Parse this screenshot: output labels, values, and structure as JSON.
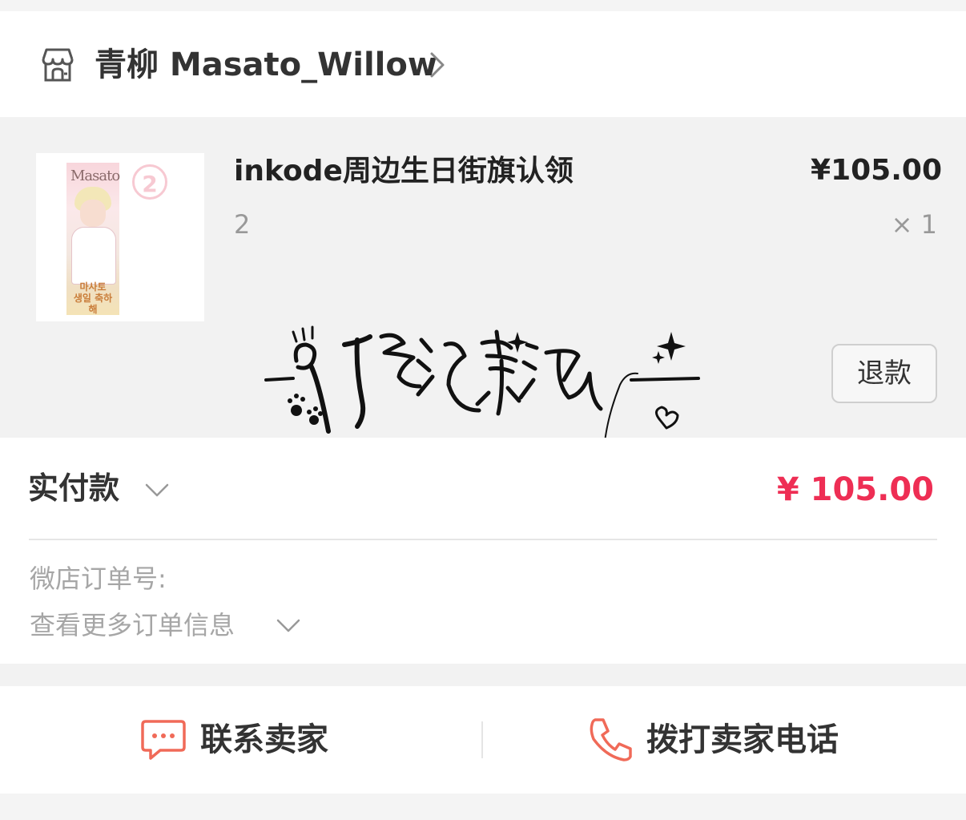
{
  "shop": {
    "name": "青柳 Masato_Willow",
    "icon": "store-icon"
  },
  "product": {
    "title": "inkode周边生日街旗认领",
    "variant": "2",
    "price": "¥105.00",
    "quantity": "× 1",
    "thumbnail": {
      "brand": "Masato",
      "badge": "2",
      "text_line1": "마사토",
      "text_line2": "생일 축하해"
    },
    "refund_label": "退款"
  },
  "payment": {
    "label": "实付款",
    "amount": "¥ 105.00",
    "amount_color": "#ee2e54"
  },
  "order": {
    "order_no_label": "微店订单号:",
    "more_info_label": "查看更多订单信息"
  },
  "actions": {
    "contact_label": "联系卖家",
    "call_label": "拨打卖家电话",
    "icon_color": "#f06a58"
  }
}
